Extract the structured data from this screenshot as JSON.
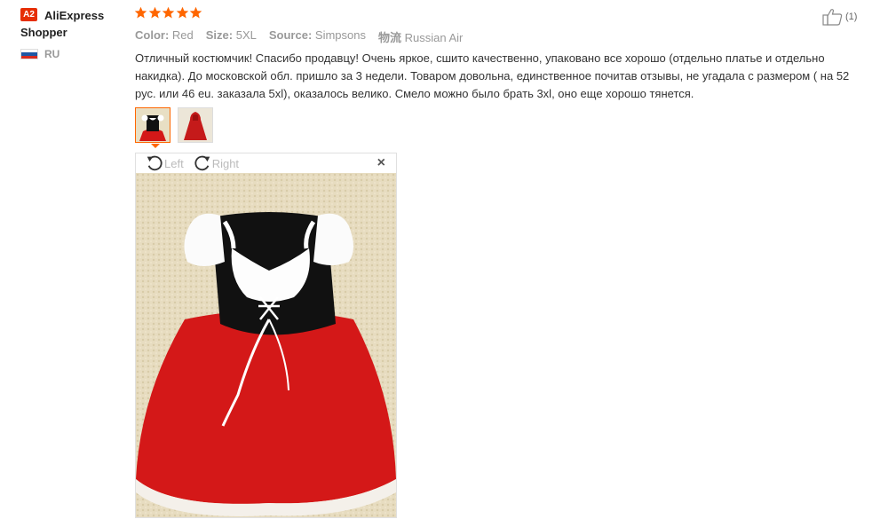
{
  "user": {
    "badge": "A2",
    "name_line1": "AliExpress",
    "name_line2": "Shopper",
    "country_code": "RU"
  },
  "rating": {
    "stars": 5,
    "star_color": "#f60"
  },
  "meta": {
    "color_label": "Color:",
    "color_value": "Red",
    "size_label": "Size:",
    "size_value": "5XL",
    "source_label": "Source:",
    "source_value": "Simpsons",
    "logistics_label": "物流",
    "logistics_value": "Russian Air"
  },
  "helpful": {
    "count": "(1)"
  },
  "review": {
    "text": "Отличный костюмчик! Спасибо продавцу! Очень яркое, сшито качественно, упаковано все хорошо (отдельно платье и отдельно накидка). До московской обл. пришло за 3 недели. Товаром довольна, единственное почитав отзывы, не угадала с размером ( на 52 рус. или 46 eu. заказала 5xl), оказалось велико. Смело можно было брать 3xl, оно еще хорошо тянется."
  },
  "viewer": {
    "rotate_left_label": "Left",
    "rotate_right_label": "Right",
    "close_glyph": "×"
  },
  "colors": {
    "accent": "#f60",
    "badge": "#e62e04",
    "dress_red": "#d41818",
    "dress_black": "#111111"
  }
}
